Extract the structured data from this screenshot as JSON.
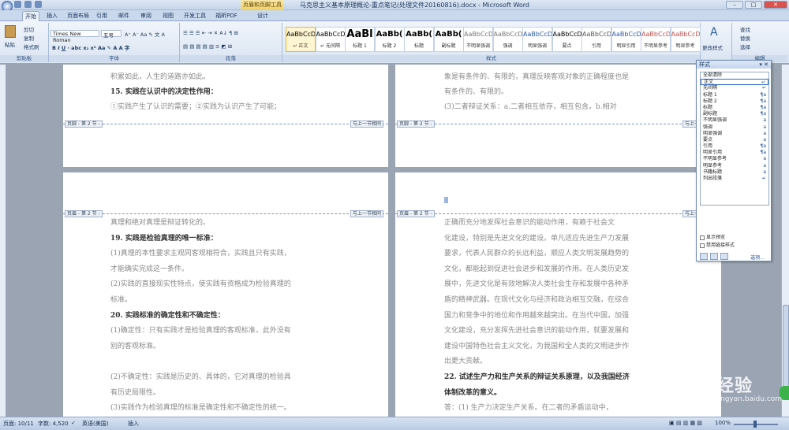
{
  "window": {
    "title": "马克思主义基本原理概论-重点笔记(处理文件20160816).docx - Microsoft Word",
    "context_title": "页眉和页脚工具"
  },
  "tabs": [
    "开始",
    "插入",
    "页面布局",
    "引用",
    "邮件",
    "审阅",
    "视图",
    "开发工具",
    "福昕PDF",
    "设计"
  ],
  "ribbon": {
    "clipboard": {
      "paste": "粘贴",
      "cut": "剪切",
      "copy": "复制",
      "format_painter": "格式刷",
      "label": "剪贴板"
    },
    "font": {
      "name": "Times New Roman",
      "size": "五号",
      "label": "字体"
    },
    "paragraph": {
      "label": "段落"
    },
    "styles": {
      "label": "样式",
      "items": [
        {
          "sample": "AaBbCcDd",
          "name": "↵ 正文"
        },
        {
          "sample": "AaBbCcDd",
          "name": "↵ 无间隔"
        },
        {
          "sample": "AaBl",
          "name": "标题 1"
        },
        {
          "sample": "AaBb(",
          "name": "标题 2"
        },
        {
          "sample": "AaBb(",
          "name": "标题"
        },
        {
          "sample": "AaBb(",
          "name": "副标题"
        },
        {
          "sample": "AaBbCcDd",
          "name": "不明显强调"
        },
        {
          "sample": "AaBbCcDd",
          "name": "强调"
        },
        {
          "sample": "AaBbCcDd",
          "name": "明显强调"
        },
        {
          "sample": "AaBbCcDd",
          "name": "要点"
        },
        {
          "sample": "AaBbCcDd",
          "name": "引用"
        },
        {
          "sample": "AaBbCcDd",
          "name": "明显引用"
        },
        {
          "sample": "AaBbCcDd",
          "name": "不明显参考"
        },
        {
          "sample": "AaBbCcDd",
          "name": "明显参考"
        }
      ],
      "change_styles": "更改样式"
    },
    "editing": {
      "find": "查找",
      "replace": "替换",
      "select": "选择",
      "label": "编辑"
    }
  },
  "pages": {
    "p1_lines": [
      {
        "text": "积累如此，人生的道路亦如此。",
        "bold": false
      },
      {
        "text": "15. 实践在认识中的决定性作用：",
        "bold": true
      },
      {
        "text": "    ①实践产生了认识的需要；②实践为认识产生了可能；",
        "bold": false
      }
    ],
    "p2_lines": [
      {
        "text": "象是有条件的、有限的，真理反映客观对象的正确程度也是",
        "bold": false
      },
      {
        "text": "有条件的、有限的。",
        "bold": false
      },
      {
        "text": "  (3)二者辩证关系：a.二者相互依存，相互包含。b.相对",
        "bold": false
      }
    ],
    "p3_lines": [
      {
        "text": "真理和绝对真理是辩证转化的。",
        "bold": false
      },
      {
        "text": "19. 实践是检验真理的唯一标准：",
        "bold": true
      },
      {
        "text": "(1)真理的本性要求主观同客观相符合，实践且只有实践，",
        "bold": false
      },
      {
        "text": "才能确实完成这一条件。",
        "bold": false
      },
      {
        "text": "(2)实践的直接现实性特点，使实践有资格成为检验真理的",
        "bold": false
      },
      {
        "text": "标准。",
        "bold": false
      },
      {
        "text": "20.   实践标准的确定性和不确定性：",
        "bold": true
      },
      {
        "text": "(1)确定性：只有实践才是检验真理的客观标准，此外没有",
        "bold": false
      },
      {
        "text": "别的客观标准。",
        "bold": false
      },
      {
        "text": "",
        "bold": false
      },
      {
        "text": "(2)不确定性：实践是历史的、具体的，它对真理的检验具",
        "bold": false
      },
      {
        "text": "有历史局限性。",
        "bold": false
      },
      {
        "text": "(3)实践作为检验真理的标准是确定性和不确定性的统一。",
        "bold": false
      }
    ],
    "p4_lines": [
      {
        "text": "    正确而充分地发挥社会意识的能动作用，有赖于社会文",
        "bold": false
      },
      {
        "text": "化建设，特别是先进文化的建设。单凡适应先进生产力发展",
        "bold": false
      },
      {
        "text": "要求，代表人民群众的长远利益，顺应人类文明发展趋势的",
        "bold": false
      },
      {
        "text": "文化，都能起到促进社会进步和发展的作用。在人类历史发",
        "bold": false
      },
      {
        "text": "展中，先进文化是有效地解决人类社会生存和发展中各种矛",
        "bold": false
      },
      {
        "text": "盾的精神武器。在现代文化与经济和政治相互交融，在综合",
        "bold": false
      },
      {
        "text": "国力和竞争中的地位和作用越来越突出。在当代中国，加强",
        "bold": false
      },
      {
        "text": "文化建设，充分发挥先进社会意识的能动作用，就要发展和",
        "bold": false
      },
      {
        "text": "建设中国特色社会主义文化，为我国和全人类的文明进步作",
        "bold": false
      },
      {
        "text": "出更大贡献。",
        "bold": false
      },
      {
        "text": "22. 试述生产力和生产关系的辩证关系原理，以及我国经济",
        "bold": true
      },
      {
        "text": "体制改革的意义。",
        "bold": true
      },
      {
        "text": "    答：(1) 生产力决定生产关系。在二者的矛盾运动中，",
        "bold": false
      }
    ],
    "footer_label": "页脚 - 第 2 节 -",
    "same_as_prev": "与上一节相同",
    "header_label": "页眉 - 第 2 节 -"
  },
  "styles_pane": {
    "title": "样式",
    "items": [
      {
        "name": "全部清除",
        "mark": ""
      },
      {
        "name": "正文",
        "mark": "↵"
      },
      {
        "name": "无间隔",
        "mark": "↵"
      },
      {
        "name": "标题 1",
        "mark": "¶a"
      },
      {
        "name": "标题 2",
        "mark": "¶a"
      },
      {
        "name": "标题",
        "mark": "¶a"
      },
      {
        "name": "副标题",
        "mark": "¶a"
      },
      {
        "name": "不明显强调",
        "mark": "a"
      },
      {
        "name": "强调",
        "mark": "a"
      },
      {
        "name": "明显强调",
        "mark": "a"
      },
      {
        "name": "要点",
        "mark": "a"
      },
      {
        "name": "引用",
        "mark": "¶a"
      },
      {
        "name": "明显引用",
        "mark": "¶a"
      },
      {
        "name": "不明显参考",
        "mark": "a"
      },
      {
        "name": "明显参考",
        "mark": "a"
      },
      {
        "name": "书籍标题",
        "mark": "a"
      },
      {
        "name": "列出段落",
        "mark": "↵"
      }
    ],
    "show_preview": "显示预览",
    "disable_linked": "禁用链接样式",
    "options": "选项..."
  },
  "status": {
    "page": "页面: 10/11",
    "words": "字数: 4,520",
    "language": "英语(美国)",
    "insert": "插入",
    "zoom": "100%"
  },
  "watermark": {
    "text": "经验",
    "sub": "jingyan.baidu.com"
  }
}
